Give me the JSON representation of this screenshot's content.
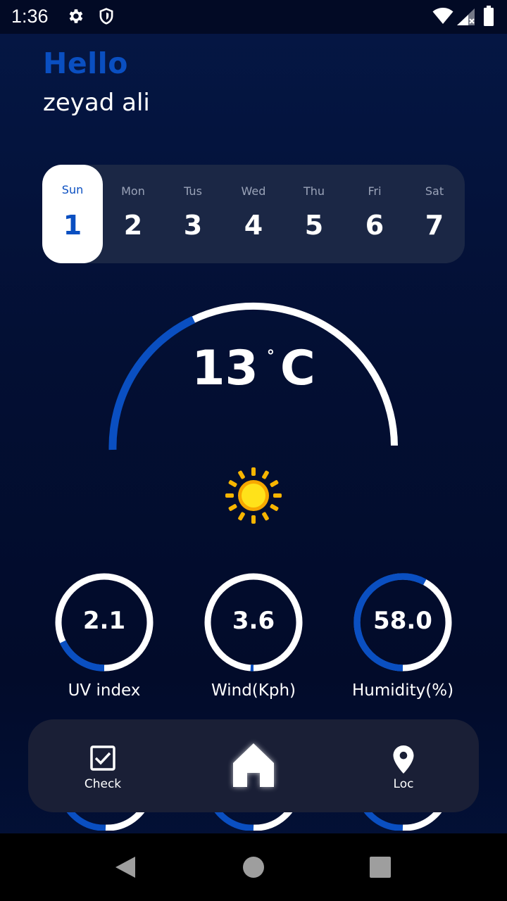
{
  "status_bar": {
    "time": "1:36",
    "icons": [
      "settings-icon",
      "shield-icon",
      "wifi-icon",
      "signal-icon",
      "battery-icon"
    ]
  },
  "greeting": {
    "hello": "Hello",
    "user_name": "zeyad ali"
  },
  "days": [
    {
      "name": "Sun",
      "num": "1",
      "selected": true
    },
    {
      "name": "Mon",
      "num": "2",
      "selected": false
    },
    {
      "name": "Tus",
      "num": "3",
      "selected": false
    },
    {
      "name": "Wed",
      "num": "4",
      "selected": false
    },
    {
      "name": "Thu",
      "num": "5",
      "selected": false
    },
    {
      "name": "Fri",
      "num": "6",
      "selected": false
    },
    {
      "name": "Sat",
      "num": "7",
      "selected": false
    }
  ],
  "weather": {
    "temperature": "13",
    "degree_symbol": "°",
    "unit": "C",
    "condition_icon": "sun-icon",
    "gauge_fill_fraction": 0.36
  },
  "metrics": [
    {
      "value": "2.1",
      "label": "UV index",
      "fill_fraction": 0.18
    },
    {
      "value": "3.6",
      "label": "Wind(Kph)",
      "fill_fraction": 0.01
    },
    {
      "value": "58.0",
      "label": "Humidity(%)",
      "fill_fraction": 0.58
    }
  ],
  "nav": {
    "check_label": "Check",
    "home_icon": "home-icon",
    "loc_label": "Loc"
  },
  "colors": {
    "accent": "#0a4fc1",
    "background": "#030f33",
    "card": "#1b2745",
    "nav_card": "#1a1f36",
    "ring_track": "#ffffff",
    "sun": "#ffd21a"
  }
}
